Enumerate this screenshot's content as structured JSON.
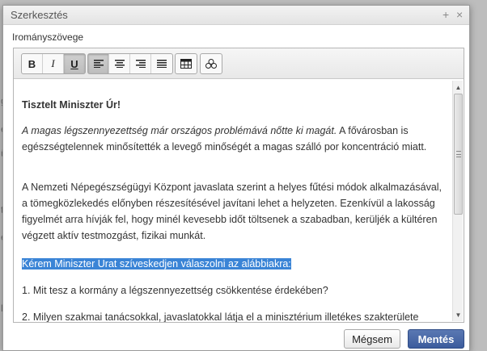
{
  "dialog": {
    "title": "Szerkesztés",
    "field_label": "Irományszövege"
  },
  "toolbar": {
    "bold": "B",
    "italic": "I",
    "underline": "U"
  },
  "backdrop": {
    "fragments": [
      "ga",
      "e",
      "ül",
      "ta",
      "er",
      "ll"
    ]
  },
  "content": {
    "heading": "Tisztelt Miniszter Úr!",
    "p1_italic": "A magas légszennyezettség már országos problémává nőtte ki magát.",
    "p1_rest": " A fővárosban is egészségtelennek minősítették a levegő minőségét a magas szálló por koncentráció miatt.",
    "p2": "A Nemzeti Népegészségügyi Központ javaslata szerint a helyes fűtési módok alkalmazásával, a tömegközlekedés előnyben részesítésével javítani lehet a helyzeten. Ezenkívül a lakosság figyelmét arra hívják fel, hogy minél kevesebb időt töltsenek a szabadban, kerüljék a kültéren végzett aktív testmozgást, fizikai munkát.",
    "p3": "Kérem Miniszter Urat szíveskedjen válaszolni az alábbiakra:",
    "p4": "1. Mit tesz a kormány a légszennyezettség csökkentése érdekében?",
    "p5": "2. Milyen szakmai tanácsokkal, javaslatokkal látja el a minisztérium illetékes szakterülete"
  },
  "buttons": {
    "cancel": "Mégsem",
    "save": "Mentés"
  },
  "colors": {
    "save_button": "#3c5c9d",
    "selection": "#3a84d6"
  }
}
